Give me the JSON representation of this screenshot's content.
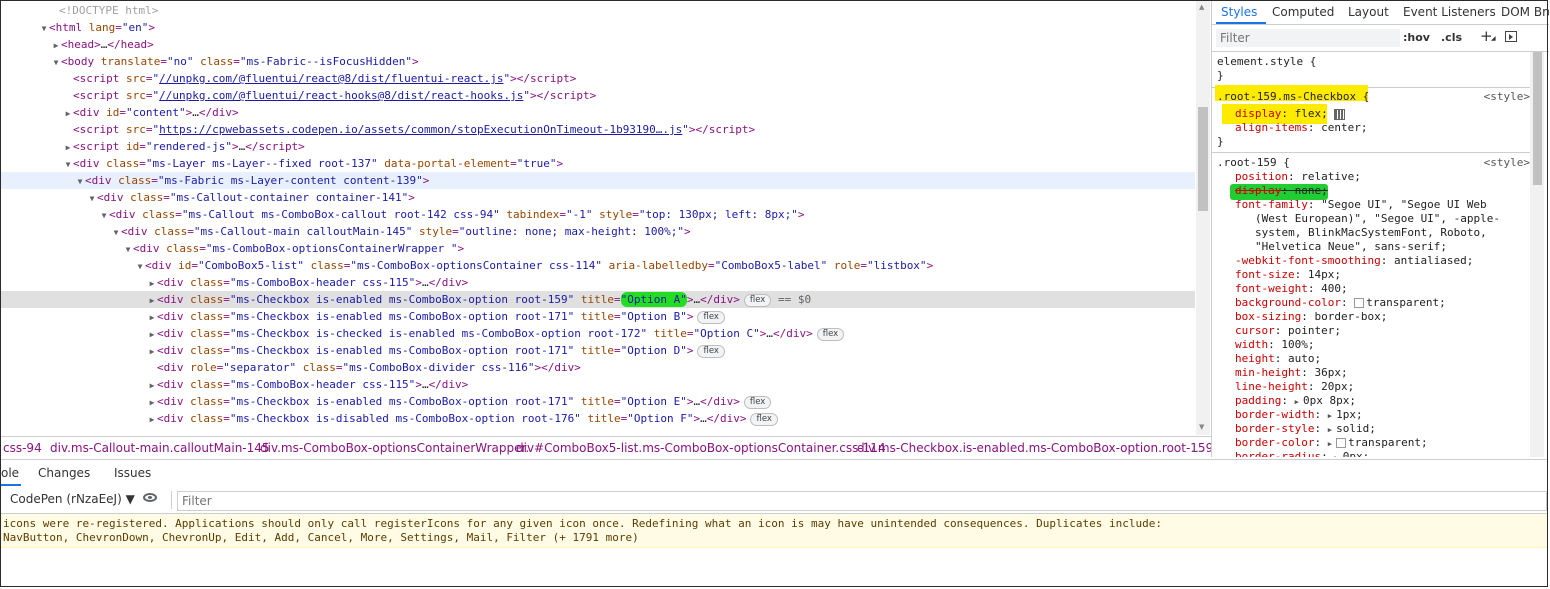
{
  "elements": {
    "lines": [
      {
        "tri": "",
        "html": "<span class=\"cm\">&lt;!DOCTYPE html&gt;</span>"
      },
      {
        "tri": "▼",
        "html": "<span class=\"t\">&lt;html</span> <span class=\"a\">lang</span><span class=\"t\">=</span><span class=\"v\">\"en\"</span><span class=\"t\">&gt;</span>"
      },
      {
        "tri": "▶",
        "html": "<span class=\"t\">&lt;head&gt;</span><span class=\"txt\">…</span><span class=\"t\">&lt;/head&gt;</span>"
      },
      {
        "tri": "▼",
        "html": "<span class=\"t\">&lt;body</span> <span class=\"a\">translate</span><span class=\"t\">=</span><span class=\"v\">\"no\"</span> <span class=\"a\">class</span><span class=\"t\">=</span><span class=\"v\">\"ms-Fabric--isFocusHidden\"</span><span class=\"t\">&gt;</span>"
      },
      {
        "tri": "",
        "html": "<span class=\"t\">&lt;script</span> <span class=\"a\">src</span><span class=\"t\">=</span><span class=\"v\">\"</span><span class=\"link\">//unpkg.com/@fluentui/react@8/dist/fluentui-react.js</span><span class=\"v\">\"</span><span class=\"t\">&gt;&lt;/script&gt;</span>"
      },
      {
        "tri": "",
        "html": "<span class=\"t\">&lt;script</span> <span class=\"a\">src</span><span class=\"t\">=</span><span class=\"v\">\"</span><span class=\"link\">//unpkg.com/@fluentui/react-hooks@8/dist/react-hooks.js</span><span class=\"v\">\"</span><span class=\"t\">&gt;&lt;/script&gt;</span>"
      },
      {
        "tri": "▶",
        "html": "<span class=\"t\">&lt;div</span> <span class=\"a\">id</span><span class=\"t\">=</span><span class=\"v\">\"content\"</span><span class=\"t\">&gt;</span><span class=\"txt\">…</span><span class=\"t\">&lt;/div&gt;</span>"
      },
      {
        "tri": "",
        "html": "<span class=\"t\">&lt;script</span> <span class=\"a\">src</span><span class=\"t\">=</span><span class=\"v\">\"</span><span class=\"link\">https://cpwebassets.codepen.io/assets/common/stopExecutionOnTimeout-1b93190….js</span><span class=\"v\">\"</span><span class=\"t\">&gt;&lt;/script&gt;</span>"
      },
      {
        "tri": "▶",
        "html": "<span class=\"t\">&lt;script</span> <span class=\"a\">id</span><span class=\"t\">=</span><span class=\"v\">\"rendered-js\"</span><span class=\"t\">&gt;</span><span class=\"txt\">…</span><span class=\"t\">&lt;/script&gt;</span>"
      },
      {
        "tri": "▼",
        "html": "<span class=\"t\">&lt;div</span> <span class=\"a\">class</span><span class=\"t\">=</span><span class=\"v\">\"ms-Layer ms-Layer--fixed root-137\"</span> <span class=\"a\">data-portal-element</span><span class=\"t\">=</span><span class=\"v\">\"true\"</span><span class=\"t\">&gt;</span>"
      },
      {
        "tri": "▼",
        "html": "<span class=\"t\">&lt;div</span> <span class=\"a\">class</span><span class=\"t\">=</span><span class=\"v\">\"ms-Fabric ms-Layer-content content-139\"</span><span class=\"t\">&gt;</span>"
      },
      {
        "tri": "▼",
        "html": "<span class=\"t\">&lt;div</span> <span class=\"a\">class</span><span class=\"t\">=</span><span class=\"v\">\"ms-Callout-container container-141\"</span><span class=\"t\">&gt;</span>"
      },
      {
        "tri": "▼",
        "html": "<span class=\"t\">&lt;div</span> <span class=\"a\">class</span><span class=\"t\">=</span><span class=\"v\">\"ms-Callout ms-ComboBox-callout root-142 css-94\"</span> <span class=\"a\">tabindex</span><span class=\"t\">=</span><span class=\"v\">\"-1\"</span> <span class=\"a\">style</span><span class=\"t\">=</span><span class=\"v\">\"top: 130px; left: 8px;\"</span><span class=\"t\">&gt;</span>"
      },
      {
        "tri": "▼",
        "html": "<span class=\"t\">&lt;div</span> <span class=\"a\">class</span><span class=\"t\">=</span><span class=\"v\">\"ms-Callout-main calloutMain-145\"</span> <span class=\"a\">style</span><span class=\"t\">=</span><span class=\"v\">\"outline: none; max-height: 100%;\"</span><span class=\"t\">&gt;</span>"
      },
      {
        "tri": "▼",
        "html": "<span class=\"t\">&lt;div</span> <span class=\"a\">class</span><span class=\"t\">=</span><span class=\"v\">\"ms-ComboBox-optionsContainerWrapper \"</span><span class=\"t\">&gt;</span>"
      },
      {
        "tri": "▼",
        "html": "<span class=\"t\">&lt;div</span> <span class=\"a\">id</span><span class=\"t\">=</span><span class=\"v\">\"ComboBox5-list\"</span> <span class=\"a\">class</span><span class=\"t\">=</span><span class=\"v\">\"ms-ComboBox-optionsContainer css-114\"</span> <span class=\"a\">aria-labelledby</span><span class=\"t\">=</span><span class=\"v\">\"ComboBox5-label\"</span> <span class=\"a\">role</span><span class=\"t\">=</span><span class=\"v\">\"listbox\"</span><span class=\"t\">&gt;</span>"
      },
      {
        "tri": "▶",
        "html": "<span class=\"t\">&lt;div</span> <span class=\"a\">class</span><span class=\"t\">=</span><span class=\"v\">\"ms-ComboBox-header css-115\"</span><span class=\"t\">&gt;</span><span class=\"txt\">…</span><span class=\"t\">&lt;/div&gt;</span>"
      },
      {
        "tri": "▶",
        "html": "<span class=\"t\">&lt;div</span> <span class=\"a\">class</span><span class=\"t\">=</span><span class=\"v\">\"ms-Checkbox is-enabled ms-ComboBox-option root-159\"</span> <span class=\"a\">title</span><span class=\"t\">=</span><span class=\"v hl-green\">\"Option A\"</span><span class=\"t\">&gt;</span><span class=\"txt\">…</span><span class=\"t\">&lt;/div&gt;</span><span class=\"flex-badge\">flex</span> <span class=\"dollar\">== $0</span>"
      },
      {
        "tri": "▶",
        "html": "<span class=\"t\">&lt;div</span> <span class=\"a\">class</span><span class=\"t\">=</span><span class=\"v\">\"ms-Checkbox is-enabled ms-ComboBox-option root-171\"</span> <span class=\"a\">title</span><span class=\"t\">=</span><span class=\"v\">\"Option B\"</span><span class=\"t\">&gt;</span><span class=\"flex-badge\">flex</span>"
      },
      {
        "tri": "▶",
        "html": "<span class=\"t\">&lt;div</span> <span class=\"a\">class</span><span class=\"t\">=</span><span class=\"v\">\"ms-Checkbox is-checked is-enabled ms-ComboBox-option root-172\"</span> <span class=\"a\">title</span><span class=\"t\">=</span><span class=\"v\">\"Option C\"</span><span class=\"t\">&gt;</span><span class=\"txt\">…</span><span class=\"t\">&lt;/div&gt;</span><span class=\"flex-badge\">flex</span>"
      },
      {
        "tri": "▶",
        "html": "<span class=\"t\">&lt;div</span> <span class=\"a\">class</span><span class=\"t\">=</span><span class=\"v\">\"ms-Checkbox is-enabled ms-ComboBox-option root-171\"</span> <span class=\"a\">title</span><span class=\"t\">=</span><span class=\"v\">\"Option D\"</span><span class=\"t\">&gt;</span><span class=\"flex-badge\">flex</span>"
      },
      {
        "tri": "",
        "html": "<span class=\"t\">&lt;div</span> <span class=\"a\">role</span><span class=\"t\">=</span><span class=\"v\">\"separator\"</span> <span class=\"a\">class</span><span class=\"t\">=</span><span class=\"v\">\"ms-ComboBox-divider css-116\"</span><span class=\"t\">&gt;&lt;/div&gt;</span>"
      },
      {
        "tri": "▶",
        "html": "<span class=\"t\">&lt;div</span> <span class=\"a\">class</span><span class=\"t\">=</span><span class=\"v\">\"ms-ComboBox-header css-115\"</span><span class=\"t\">&gt;</span><span class=\"txt\">…</span><span class=\"t\">&lt;/div&gt;</span>"
      },
      {
        "tri": "▶",
        "html": "<span class=\"t\">&lt;div</span> <span class=\"a\">class</span><span class=\"t\">=</span><span class=\"v\">\"ms-Checkbox is-enabled ms-ComboBox-option root-171\"</span> <span class=\"a\">title</span><span class=\"t\">=</span><span class=\"v\">\"Option E\"</span><span class=\"t\">&gt;</span><span class=\"txt\">…</span><span class=\"t\">&lt;/div&gt;</span><span class=\"flex-badge\">flex</span>"
      },
      {
        "tri": "▶",
        "html": "<span class=\"t\">&lt;div</span> <span class=\"a\">class</span><span class=\"t\">=</span><span class=\"v\">\"ms-Checkbox is-disabled ms-ComboBox-option root-176\"</span> <span class=\"a\">title</span><span class=\"t\">=</span><span class=\"v\">\"Option F\"</span><span class=\"t\">&gt;</span><span class=\"txt\">…</span><span class=\"t\">&lt;/div&gt;</span><span class=\"flex-badge\">flex</span>"
      }
    ]
  },
  "styles": {
    "tabs": [
      "Styles",
      "Computed",
      "Layout",
      "Event Listeners",
      "DOM Bre"
    ],
    "filter_placeholder": "Filter",
    "hov_label": ":hov",
    "cls_label": ".cls",
    "plus_label": "+",
    "element_style": {
      "selector": "element.style {",
      "close": "}"
    },
    "rule1": {
      "selector": ".root-159.ms-Checkbox {",
      "origin": "<style>",
      "p1": "display",
      "v1": "flex;",
      "p2": "align-items",
      "v2": "center;",
      "close": "}"
    },
    "rule2": {
      "selector": ".root-159 {",
      "origin": "<style>",
      "props": [
        {
          "p": "position",
          "v": "relative;"
        },
        {
          "p": "display",
          "v": "none;"
        },
        {
          "p": "font-family",
          "v": "\"Segoe UI\", \"Segoe UI Web"
        },
        {
          "p": "",
          "v": "(West European)\", \"Segoe UI\", -apple-"
        },
        {
          "p": "",
          "v": "system, BlinkMacSystemFont, Roboto,"
        },
        {
          "p": "",
          "v": "\"Helvetica Neue\", sans-serif;"
        },
        {
          "p": "-webkit-font-smoothing",
          "v": "antialiased;"
        },
        {
          "p": "font-size",
          "v": "14px;"
        },
        {
          "p": "font-weight",
          "v": "400;"
        },
        {
          "p": "background-color",
          "v": "transparent;"
        },
        {
          "p": "box-sizing",
          "v": "border-box;"
        },
        {
          "p": "cursor",
          "v": "pointer;"
        },
        {
          "p": "width",
          "v": "100%;"
        },
        {
          "p": "height",
          "v": "auto;"
        },
        {
          "p": "min-height",
          "v": "36px;"
        },
        {
          "p": "line-height",
          "v": "20px;"
        },
        {
          "p": "padding",
          "v": "0px 8px;"
        },
        {
          "p": "border-width",
          "v": "1px;"
        },
        {
          "p": "border-style",
          "v": "solid;"
        },
        {
          "p": "border-color",
          "v": "transparent;"
        },
        {
          "p": "border-radius",
          "v": "0px;"
        }
      ]
    }
  },
  "breadcrumb": [
    "css-94",
    "div.ms-Callout-main.calloutMain-145",
    "div.ms-ComboBox-optionsContainerWrapper.",
    "div#ComboBox5-list.ms-ComboBox-optionsContainer.css-114",
    "div.ms-Checkbox.is-enabled.ms-ComboBox-option.root-159",
    "…"
  ],
  "drawer": {
    "tabs": [
      "ole",
      "Changes",
      "Issues"
    ],
    "context": "CodePen (rNzaEeJ) ▼",
    "filter_placeholder": "Filter"
  },
  "warning": {
    "line1": "icons were re-registered. Applications should only call registerIcons for any given icon once. Redefining what an icon is may have unintended consequences. Duplicates include:",
    "line2": "NavButton, ChevronDown, ChevronUp, Edit, Add, Cancel, More, Settings, Mail, Filter (+ 1791 more)"
  },
  "colors": {
    "highlight_yellow": "#ffeb00",
    "highlight_green": "#22cc33",
    "tag": "#881280",
    "attr": "#994500",
    "value": "#1a1aa6",
    "accent": "#1a73e8"
  }
}
